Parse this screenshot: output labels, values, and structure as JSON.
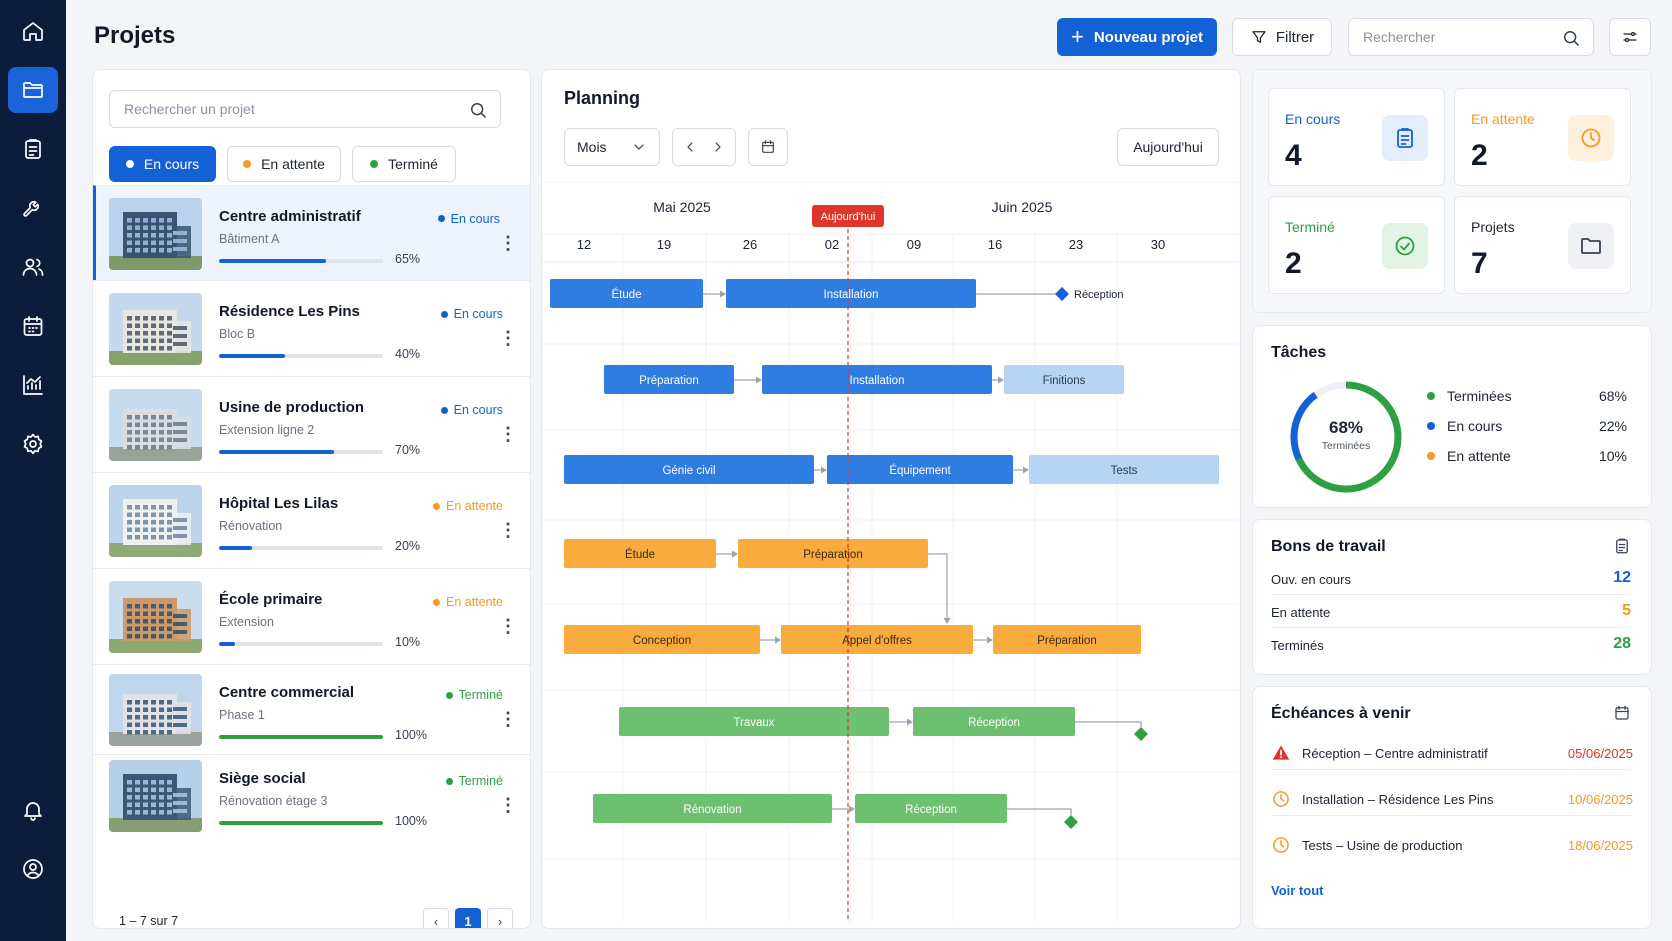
{
  "header": {
    "title": "Projets",
    "new_project_label": "Nouveau projet",
    "filter_label": "Filtrer",
    "search_placeholder": "Rechercher"
  },
  "sidebar": {
    "items": [
      "home-icon",
      "folder-icon",
      "clipboard-icon",
      "wrench-icon",
      "users-icon",
      "calendar-icon",
      "chart-icon",
      "settings-icon",
      "bell-icon",
      "user-circle-icon"
    ],
    "active": "folder-icon"
  },
  "projects": {
    "search_placeholder": "Rechercher un projet",
    "filters": [
      {
        "label": "En cours",
        "color": "#1262d6",
        "active": true
      },
      {
        "label": "En attente",
        "color": "#f59a23",
        "active": false
      },
      {
        "label": "Terminé",
        "color": "#2ea043",
        "active": false
      }
    ],
    "items": [
      {
        "name": "Centre administratif",
        "sub": "Bâtiment A",
        "status": "En cours",
        "status_color": "#1262d6",
        "progress": 0.65,
        "pct_label": "65%",
        "selected": true
      },
      {
        "name": "Résidence Les Pins",
        "sub": "Bloc B",
        "status": "En cours",
        "status_color": "#1262d6",
        "progress": 0.4,
        "pct_label": "40%"
      },
      {
        "name": "Usine de production",
        "sub": "Extension ligne 2",
        "status": "En cours",
        "status_color": "#1262d6",
        "progress": 0.7,
        "pct_label": "70%"
      },
      {
        "name": "Hôpital Les Lilas",
        "sub": "Rénovation",
        "status": "En attente",
        "status_color": "#f59a23",
        "progress": 0.2,
        "pct_label": "20%"
      },
      {
        "name": "École primaire",
        "sub": "Extension",
        "status": "En attente",
        "status_color": "#f59a23",
        "progress": 0.1,
        "pct_label": "10%"
      },
      {
        "name": "Centre commercial",
        "sub": "Phase 1",
        "status": "Terminé",
        "status_color": "#2ea043",
        "progress": 1.0,
        "pct_label": "100%"
      },
      {
        "name": "Siège social",
        "sub": "Rénovation étage 3",
        "status": "Terminé",
        "status_color": "#2ea043",
        "progress": 1.0,
        "pct_label": "100%"
      }
    ],
    "pager_text": "1 – 7 sur 7",
    "page": "1"
  },
  "planning": {
    "title": "Planning",
    "view": "Mois",
    "today_button": "Aujourd'hui",
    "today_marker": "Aujourd'hui",
    "months": [
      "Mai 2025",
      "Juin 2025"
    ],
    "days": [
      "12",
      "19",
      "26",
      "02",
      "09",
      "16",
      "23",
      "30"
    ],
    "rows": [
      {
        "tasks": [
          {
            "label": "Étude",
            "c": "blue"
          },
          {
            "label": "Installation",
            "c": "blue"
          }
        ],
        "milestone": {
          "label": "Réception",
          "c": "blue"
        }
      },
      {
        "tasks": [
          {
            "label": "Préparation",
            "c": "blue"
          },
          {
            "label": "Installation",
            "c": "blue"
          },
          {
            "label": "Finitions",
            "c": "lightblue"
          }
        ]
      },
      {
        "tasks": [
          {
            "label": "Génie civil",
            "c": "blue"
          },
          {
            "label": "Équipement",
            "c": "blue"
          },
          {
            "label": "Tests",
            "c": "lightblue"
          }
        ]
      },
      {
        "tasks": [
          {
            "label": "Étude",
            "c": "orange"
          },
          {
            "label": "Préparation",
            "c": "orange"
          }
        ]
      },
      {
        "tasks": [
          {
            "label": "Conception",
            "c": "orange"
          },
          {
            "label": "Appel d'offres",
            "c": "orange"
          },
          {
            "label": "Préparation",
            "c": "orange"
          }
        ]
      },
      {
        "tasks": [
          {
            "label": "Travaux",
            "c": "green"
          },
          {
            "label": "Réception",
            "c": "green"
          }
        ],
        "milestone": {
          "c": "green"
        }
      },
      {
        "tasks": [
          {
            "label": "Rénovation",
            "c": "green"
          },
          {
            "label": "Réception",
            "c": "green"
          }
        ],
        "milestone": {
          "c": "green"
        }
      }
    ]
  },
  "kpis": [
    {
      "label": "En cours",
      "value": "4",
      "color": "#1262d6",
      "icon": "clipboard-icon"
    },
    {
      "label": "En attente",
      "value": "2",
      "color": "#f59a23",
      "icon": "clock-icon"
    },
    {
      "label": "Terminé",
      "value": "2",
      "color": "#2ea043",
      "icon": "check-circle-icon"
    },
    {
      "label": "Projets",
      "value": "7",
      "color": "#1d2433",
      "icon": "folder-icon"
    }
  ],
  "taches": {
    "title": "Tâches",
    "center_value": "68%",
    "center_label": "Terminées",
    "legend": [
      {
        "label": "Terminées",
        "value": "68%",
        "fraction": 0.68,
        "color": "#2ea043"
      },
      {
        "label": "En cours",
        "value": "22%",
        "fraction": 0.22,
        "color": "#1262d6"
      },
      {
        "label": "En attente",
        "value": "10%",
        "fraction": 0.1,
        "color": "#f59a23"
      }
    ]
  },
  "bons": {
    "title": "Bons de travail",
    "rows": [
      {
        "label": "Ouv. en cours",
        "value": "12",
        "color": "#1262d6"
      },
      {
        "label": "En attente",
        "value": "5",
        "color": "#f59a23"
      },
      {
        "label": "Terminés",
        "value": "28",
        "color": "#2ea043"
      }
    ]
  },
  "echeances": {
    "title": "Échéances à venir",
    "rows": [
      {
        "label": "Réception – Centre administratif",
        "date": "05/06/2025",
        "color": "#e0352b",
        "icon": "warning-icon"
      },
      {
        "label": "Installation – Résidence Les Pins",
        "date": "10/06/2025",
        "color": "#f59a23",
        "icon": "clock-icon"
      },
      {
        "label": "Tests – Usine de production",
        "date": "18/06/2025",
        "color": "#f59a23",
        "icon": "clock-icon"
      }
    ],
    "see_all": "Voir tout"
  }
}
